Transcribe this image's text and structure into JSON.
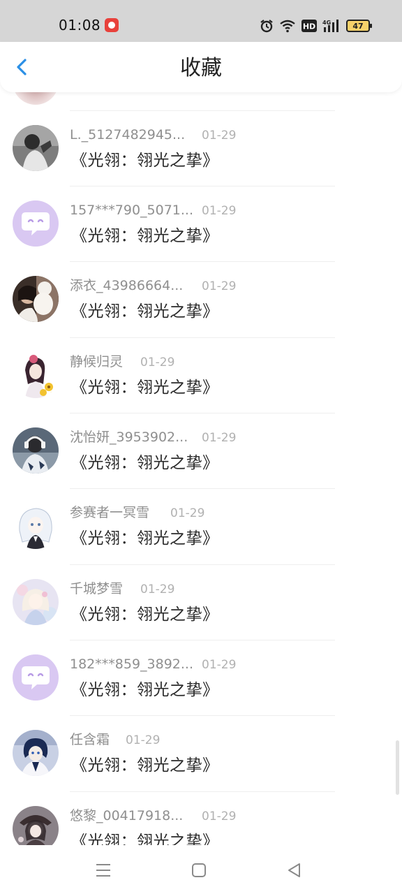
{
  "status_bar": {
    "time": "01:08",
    "battery": "47",
    "icons": [
      "app-notification-icon",
      "alarm-icon",
      "wifi-icon",
      "hd-icon",
      "4g-signal-icon",
      "battery-icon"
    ],
    "hd_label": "HD",
    "network_label": "4G"
  },
  "header": {
    "back_icon": "chevron-left-icon",
    "title": "收藏",
    "accent_color": "#2b8fe6"
  },
  "items": [
    {
      "name": "L._5127482945...",
      "date": "01-29",
      "title": "《光翎：翎光之挚》",
      "avatar": "photo-girl-bw"
    },
    {
      "name": "157***790_5071...",
      "date": "01-29",
      "title": "《光翎：翎光之挚》",
      "avatar": "default-chat"
    },
    {
      "name": "添衣_43986664...",
      "date": "01-29",
      "title": "《光翎：翎光之挚》",
      "avatar": "photo-girl-dog"
    },
    {
      "name": "静候归灵",
      "date": "01-29",
      "title": "《光翎：翎光之挚》",
      "avatar": "anime-girl-flowers"
    },
    {
      "name": "沈怡妍_3953902...",
      "date": "01-29",
      "title": "《光翎：翎光之挚》",
      "avatar": "photo-headphones"
    },
    {
      "name": "参赛者一冥雪",
      "date": "01-29",
      "title": "《光翎：翎光之挚》",
      "avatar": "anime-white-hair"
    },
    {
      "name": "千城梦雪",
      "date": "01-29",
      "title": "《光翎：翎光之挚》",
      "avatar": "anime-pastel"
    },
    {
      "name": "182***859_3892...",
      "date": "01-29",
      "title": "《光翎：翎光之挚》",
      "avatar": "default-chat"
    },
    {
      "name": "任含霜",
      "date": "01-29",
      "title": "《光翎：翎光之挚》",
      "avatar": "anime-boy-blue"
    },
    {
      "name": "悠黎_00417918...",
      "date": "01-29",
      "title": "《光翎：翎光之挚》",
      "avatar": "anime-dark-hat"
    }
  ],
  "nav_bar": {
    "icons": [
      "menu-icon",
      "home-square-icon",
      "back-triangle-icon"
    ]
  }
}
